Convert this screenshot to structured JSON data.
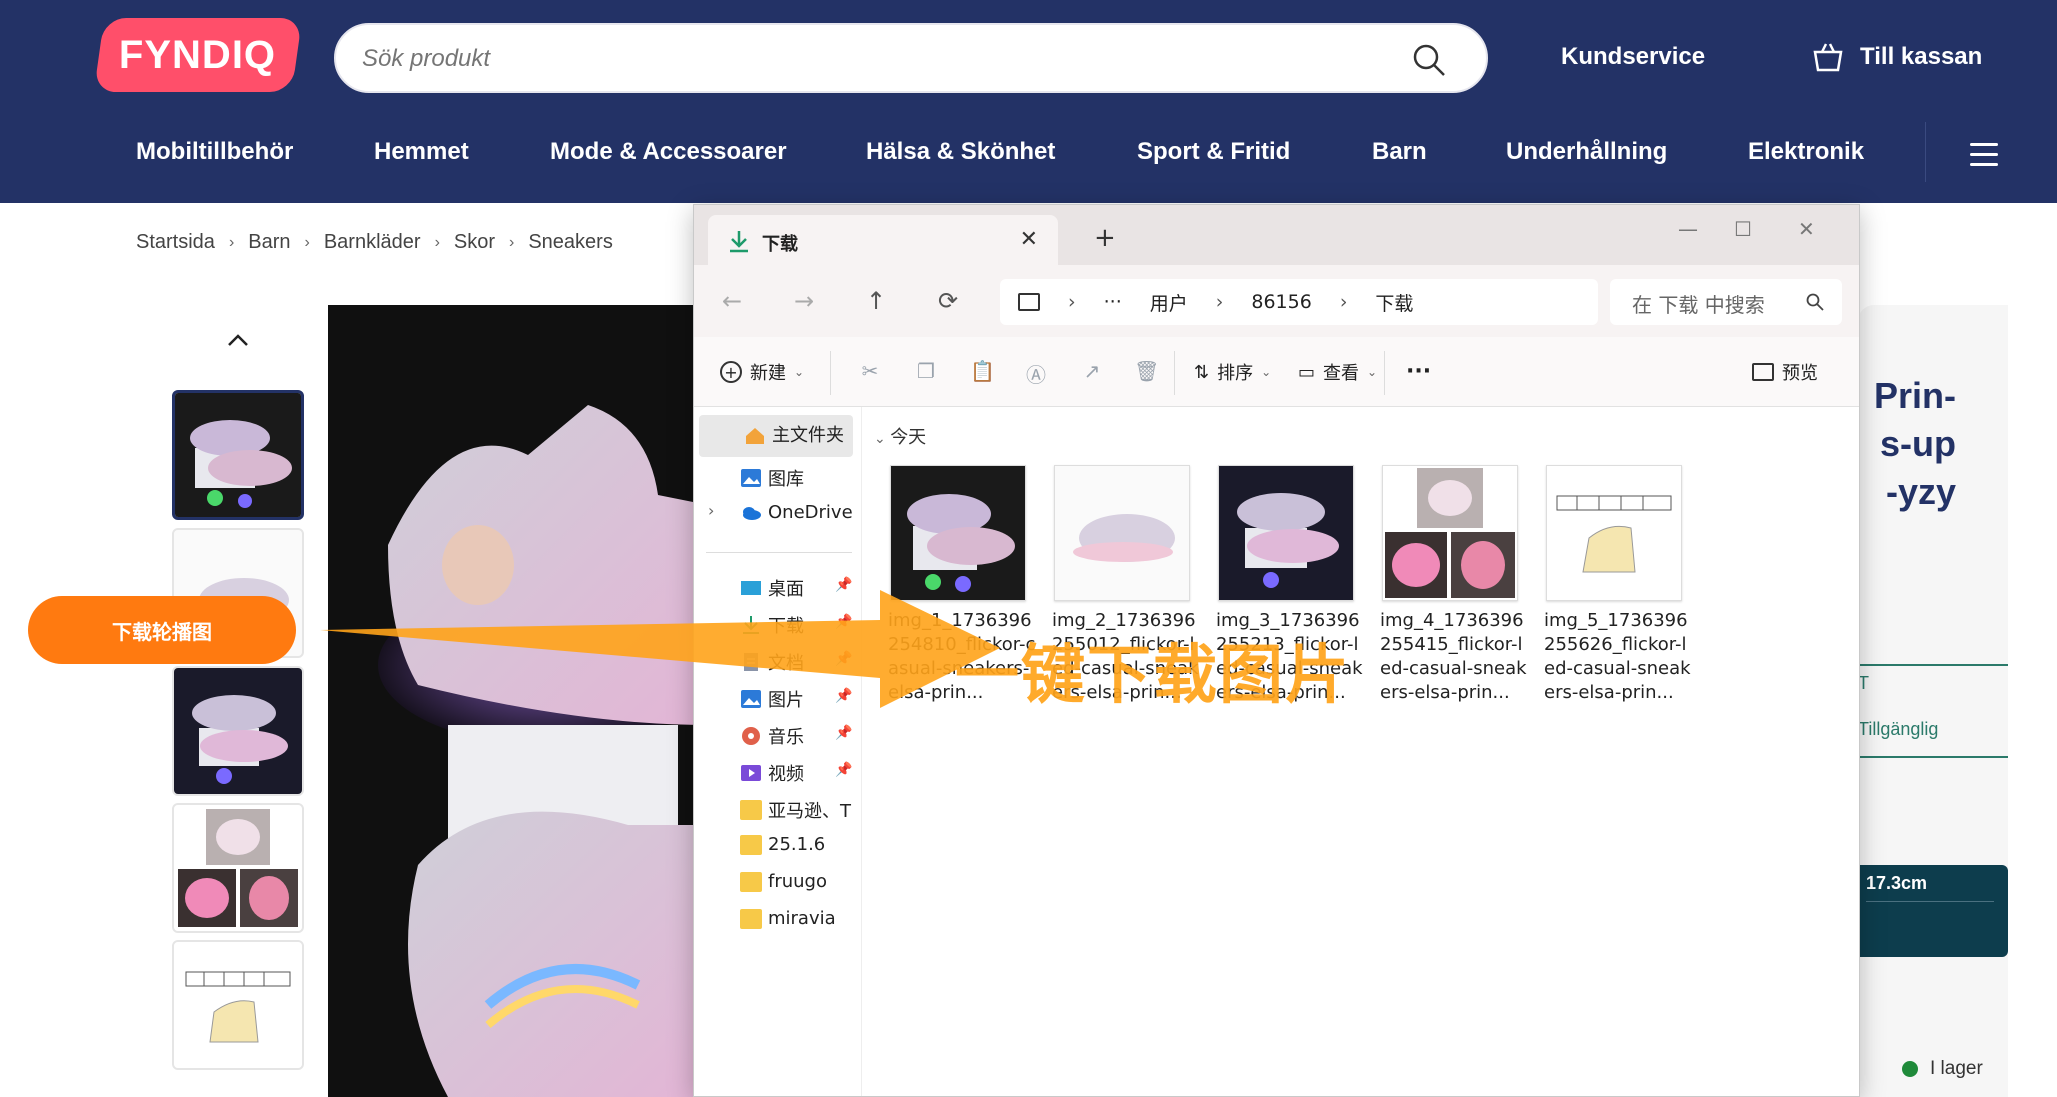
{
  "header": {
    "logo": "FYNDIQ",
    "search_placeholder": "Sök produkt",
    "customer_service": "Kundservice",
    "checkout": "Till kassan"
  },
  "nav": [
    "Mobiltillbehör",
    "Hemmet",
    "Mode & Accessoarer",
    "Hälsa & Skönhet",
    "Sport & Fritid",
    "Barn",
    "Underhållning",
    "Elektronik"
  ],
  "breadcrumb": [
    "Startsida",
    "Barn",
    "Barnkläder",
    "Skor",
    "Sneakers"
  ],
  "product_panel": {
    "title_lines": [
      "Prin-",
      "s-up",
      "-yzy"
    ],
    "fragment_1": "T",
    "availability": "Tillgänglig",
    "size_label": "17.3cm",
    "stock": "I lager"
  },
  "download_button": "下载轮播图",
  "overlay_text": "一键下载图片",
  "explorer": {
    "tab_title": "下载",
    "path": [
      "用户",
      "86156",
      "下载"
    ],
    "search_placeholder": "在 下载 中搜索",
    "toolbar": {
      "new": "新建",
      "sort": "排序",
      "view": "查看",
      "preview": "预览"
    },
    "sidebar": [
      {
        "label": "主文件夹",
        "icon": "home-icon"
      },
      {
        "label": "图库",
        "icon": "gallery-icon"
      },
      {
        "label": "OneDrive",
        "icon": "onedrive-icon"
      },
      {
        "label": "桌面",
        "icon": "desktop-icon"
      },
      {
        "label": "下载",
        "icon": "download-icon"
      },
      {
        "label": "文档",
        "icon": "document-icon"
      },
      {
        "label": "图片",
        "icon": "pictures-icon"
      },
      {
        "label": "音乐",
        "icon": "music-icon"
      },
      {
        "label": "视频",
        "icon": "video-icon"
      },
      {
        "label": "亚马逊、T",
        "icon": "folder-icon"
      },
      {
        "label": "25.1.6",
        "icon": "folder-icon"
      },
      {
        "label": "fruugo",
        "icon": "folder-icon"
      },
      {
        "label": "miravia",
        "icon": "folder-icon"
      }
    ],
    "group_label": "今天",
    "files": [
      "img_1_1736396254810_flickor-casual-sneakers-elsa-prin...",
      "img_2_1736396255012_flickor-led-casual-sneakers-elsa-prin...",
      "img_3_1736396255213_flickor-led-casual-sneakers-elsa-prin...",
      "img_4_1736396255415_flickor-led-casual-sneakers-elsa-prin...",
      "img_5_1736396255626_flickor-led-casual-sneakers-elsa-prin..."
    ]
  },
  "colors": {
    "brand_bg": "#233266",
    "logo": "#ff4f6a",
    "download_btn": "#ff7a10",
    "overlay": "#ffa31a"
  }
}
